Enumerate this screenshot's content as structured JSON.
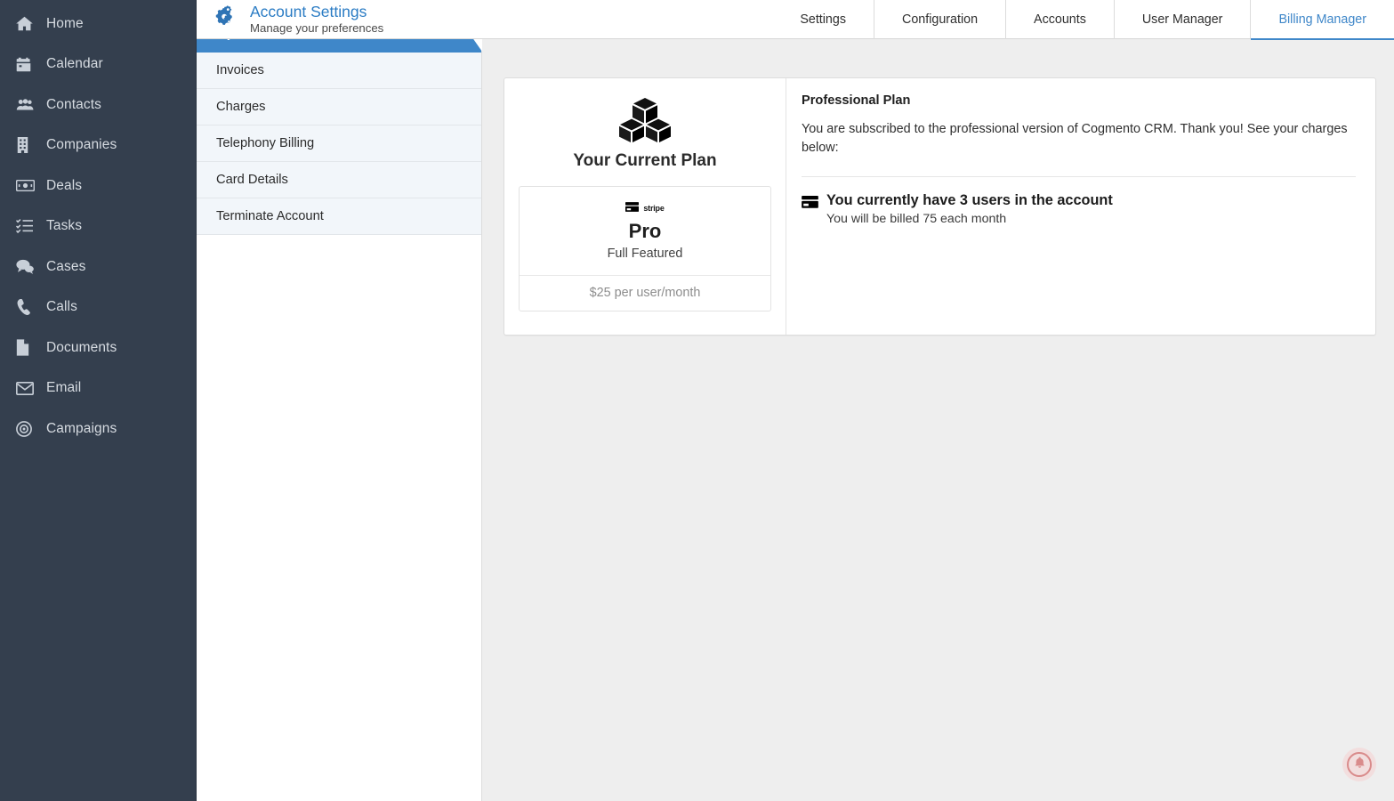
{
  "sidebar": {
    "items": [
      {
        "label": "Home",
        "icon": "home-icon"
      },
      {
        "label": "Calendar",
        "icon": "calendar-icon"
      },
      {
        "label": "Contacts",
        "icon": "contacts-icon"
      },
      {
        "label": "Companies",
        "icon": "building-icon"
      },
      {
        "label": "Deals",
        "icon": "money-bill-icon"
      },
      {
        "label": "Tasks",
        "icon": "tasks-list-icon"
      },
      {
        "label": "Cases",
        "icon": "comments-icon"
      },
      {
        "label": "Calls",
        "icon": "phone-icon"
      },
      {
        "label": "Documents",
        "icon": "document-icon"
      },
      {
        "label": "Email",
        "icon": "envelope-icon"
      },
      {
        "label": "Campaigns",
        "icon": "bullseye-icon"
      }
    ]
  },
  "header": {
    "title": "Account Settings",
    "subtitle": "Manage your preferences",
    "icon": "gears-icon",
    "title_color": "#2b7cc4",
    "tabs": [
      {
        "label": "Settings",
        "active": false
      },
      {
        "label": "Configuration",
        "active": false
      },
      {
        "label": "Accounts",
        "active": false
      },
      {
        "label": "User Manager",
        "active": false
      },
      {
        "label": "Billing Manager",
        "active": true
      }
    ],
    "active_tab_color": "#3f87c9"
  },
  "submenu": {
    "items": [
      {
        "label": "My Plan",
        "active": true
      },
      {
        "label": "Invoices",
        "active": false
      },
      {
        "label": "Charges",
        "active": false
      },
      {
        "label": "Telephony Billing",
        "active": false
      },
      {
        "label": "Card Details",
        "active": false
      },
      {
        "label": "Terminate Account",
        "active": false
      }
    ],
    "active_color": "#3f87c9",
    "item_bg": "#f2f6fa"
  },
  "plan_card": {
    "icon": "cubes-icon",
    "heading": "Your Current Plan",
    "provider_badge": {
      "icon": "credit-card-icon",
      "label": "stripe"
    },
    "plan_name": "Pro",
    "plan_feature": "Full Featured",
    "plan_price": "$25 per user/month"
  },
  "plan_details": {
    "title": "Professional Plan",
    "description": "You are subscribed to the professional version of Cogmento CRM. Thank you! See your charges below:",
    "usage": {
      "icon": "credit-card-icon",
      "headline": "You currently have 3 users in the account",
      "subline": "You will be billed 75 each month"
    }
  },
  "notification": {
    "icon": "bell-icon",
    "color": "#d98b8b",
    "background": "#f2dede"
  }
}
